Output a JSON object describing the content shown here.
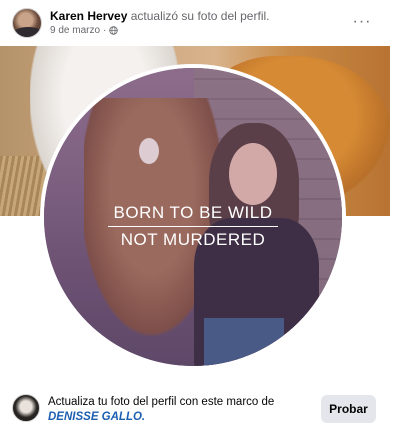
{
  "post": {
    "author_name": "Karen Hervey",
    "action_text": "actualizó su foto del perfil.",
    "date": "9 de marzo",
    "separator": "·",
    "privacy_icon": "globe-icon",
    "more_icon": "···"
  },
  "profile_frame": {
    "line1": "BORN TO BE WILD",
    "line2": "NOT MURDERED"
  },
  "footer": {
    "prompt_text": "Actualiza tu foto del perfil con este marco de",
    "frame_creator": "DENISSE GALLO.",
    "try_button_label": "Probar"
  },
  "colors": {
    "link": "#1c5fb0",
    "secondary_text": "#65676b",
    "button_bg": "#e4e6eb"
  }
}
